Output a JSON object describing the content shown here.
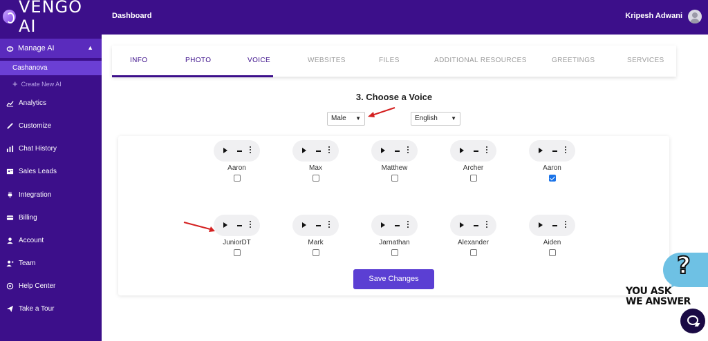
{
  "app": {
    "brand": "VENGO AI"
  },
  "header": {
    "breadcrumb": "Dashboard",
    "user_name": "Kripesh Adwani"
  },
  "sidebar": {
    "manage_ai_label": "Manage AI",
    "active_ai": "Cashanova",
    "create_new_label": "Create New AI",
    "items": [
      {
        "label": "Analytics",
        "icon": "chart-line-icon"
      },
      {
        "label": "Customize",
        "icon": "brush-icon"
      },
      {
        "label": "Chat History",
        "icon": "bar-chart-icon"
      },
      {
        "label": "Sales Leads",
        "icon": "contact-card-icon"
      },
      {
        "label": "Integration",
        "icon": "plug-icon"
      },
      {
        "label": "Billing",
        "icon": "credit-card-icon"
      },
      {
        "label": "Account",
        "icon": "user-icon"
      },
      {
        "label": "Team",
        "icon": "user-plus-icon"
      },
      {
        "label": "Help Center",
        "icon": "help-circle-icon"
      },
      {
        "label": "Take a Tour",
        "icon": "paper-plane-icon"
      }
    ]
  },
  "tabs": [
    {
      "label": "INFO",
      "active": false
    },
    {
      "label": "PHOTO",
      "active": false
    },
    {
      "label": "VOICE",
      "active": true
    },
    {
      "label": "WEBSITES",
      "active": false
    },
    {
      "label": "FILES",
      "active": false
    },
    {
      "label": "ADDITIONAL RESOURCES",
      "active": false
    },
    {
      "label": "GREETINGS",
      "active": false
    },
    {
      "label": "SERVICES",
      "active": false
    }
  ],
  "voice_section": {
    "title": "3. Choose a Voice",
    "gender_select": "Male",
    "language_select": "English",
    "voices": [
      {
        "name": "Aaron",
        "checked": false
      },
      {
        "name": "Max",
        "checked": false
      },
      {
        "name": "Matthew",
        "checked": false
      },
      {
        "name": "Archer",
        "checked": false
      },
      {
        "name": "Aaron",
        "checked": true
      },
      {
        "name": "JuniorDT",
        "checked": false
      },
      {
        "name": "Mark",
        "checked": false
      },
      {
        "name": "Jarnathan",
        "checked": false
      },
      {
        "name": "Alexander",
        "checked": false
      },
      {
        "name": "Aiden",
        "checked": false
      }
    ],
    "save_label": "Save Changes"
  },
  "badge": {
    "line1": "YOU ASK",
    "line2": "WE ANSWER",
    "symbol": "?"
  },
  "colors": {
    "primary": "#3c0f8a",
    "accent": "#5b3fd3",
    "arrow": "#d42020"
  }
}
